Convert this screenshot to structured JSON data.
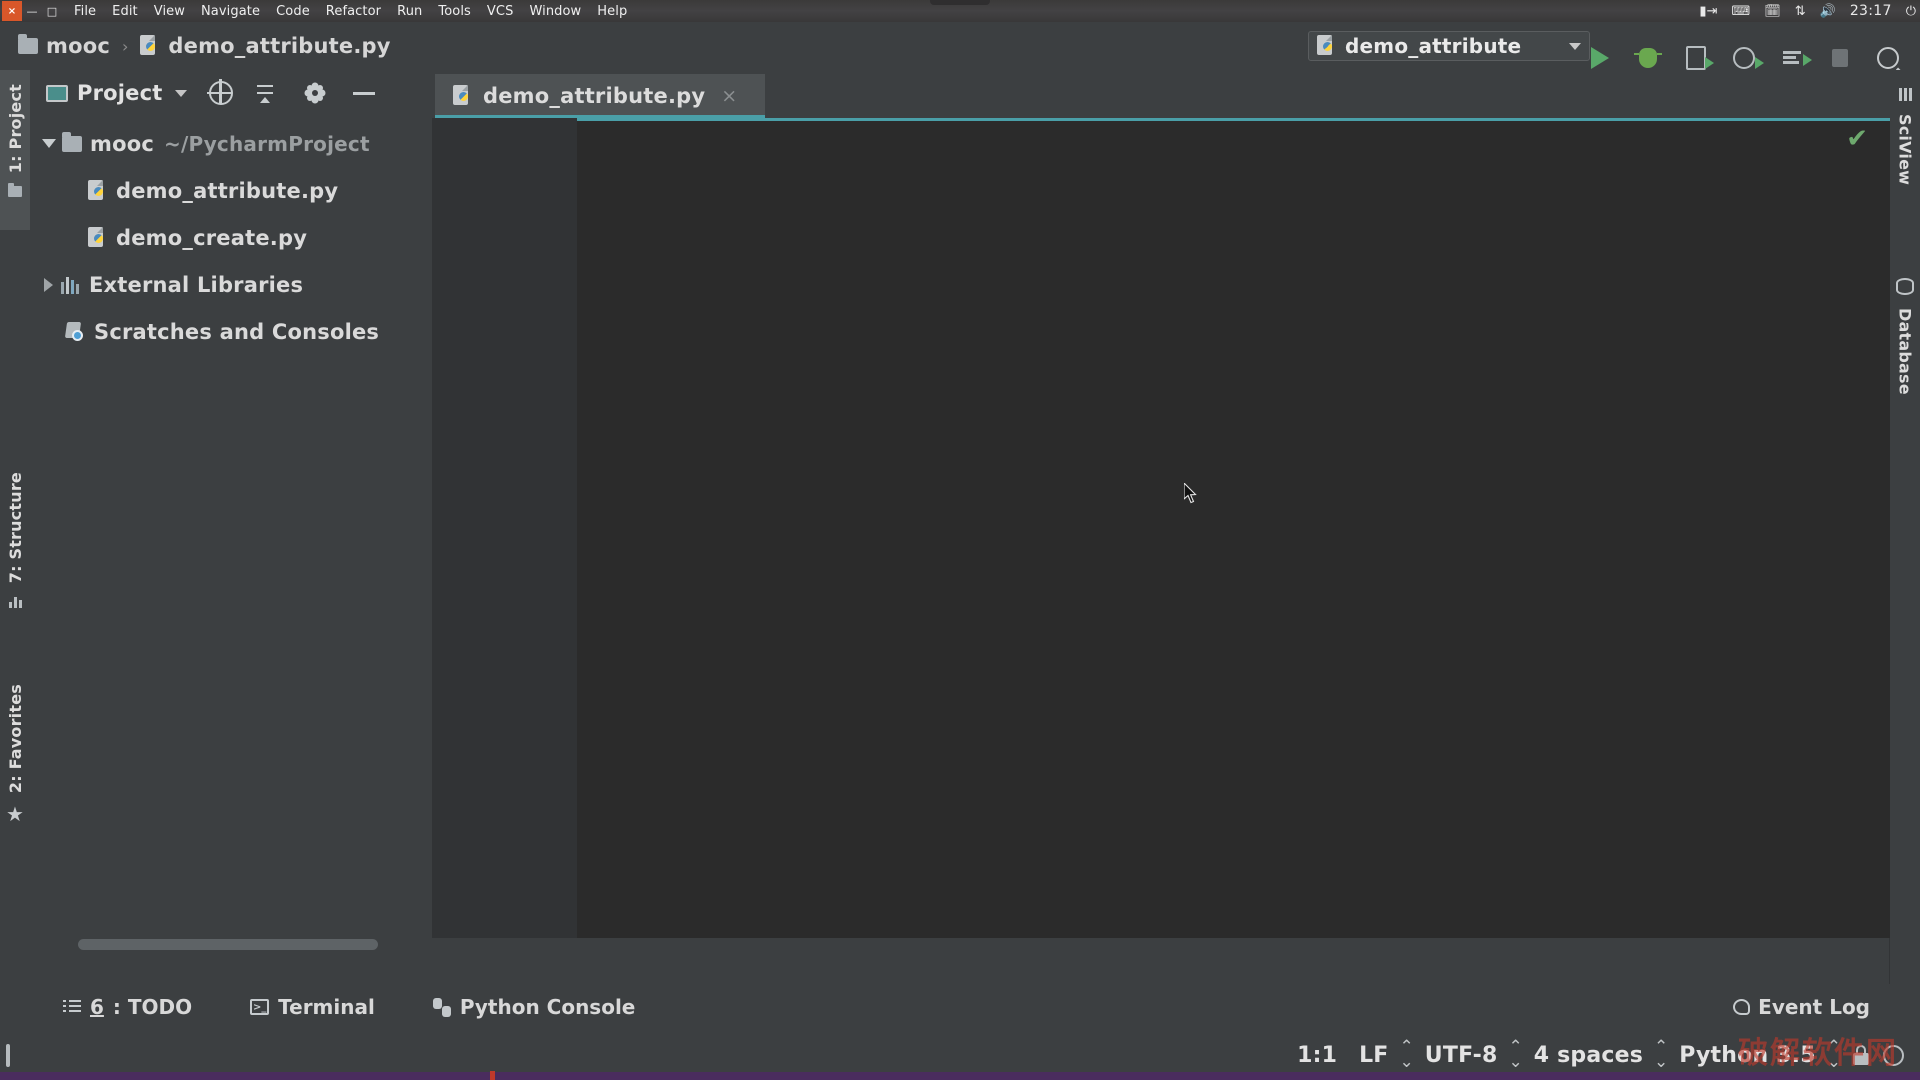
{
  "os_bar": {
    "window_controls": [
      {
        "name": "close",
        "glyph": "×"
      },
      {
        "name": "minimize",
        "glyph": "—"
      },
      {
        "name": "maximize",
        "glyph": "□"
      }
    ],
    "menus": [
      "File",
      "Edit",
      "View",
      "Navigate",
      "Code",
      "Refactor",
      "Run",
      "Tools",
      "VCS",
      "Window",
      "Help"
    ],
    "tray": {
      "input_method_icon": "keyboard-switch-icon",
      "keyboard_icon": "keyboard-icon",
      "calendar_icon": "calendar-icon",
      "network_icon": "network-updown-icon",
      "volume_icon": "volume-icon",
      "clock": "23:17",
      "power_icon": "power-icon"
    }
  },
  "navbar": {
    "breadcrumbs": [
      {
        "label": "mooc",
        "icon": "folder-icon"
      },
      {
        "label": "demo_attribute.py",
        "icon": "python-file-icon"
      }
    ],
    "separator": "›",
    "run_config": {
      "name": "demo_attribute",
      "icon": "python-config-icon",
      "caret": "chevron-down-icon"
    },
    "toolbar_buttons": [
      {
        "name": "run-button",
        "icon": "play-icon"
      },
      {
        "name": "debug-button",
        "icon": "bug-icon"
      },
      {
        "name": "run-with-coverage-button",
        "icon": "coverage-icon"
      },
      {
        "name": "profile-button",
        "icon": "profile-icon"
      },
      {
        "name": "run-with-console-button",
        "icon": "console-run-icon"
      },
      {
        "name": "stop-button",
        "icon": "stop-icon"
      },
      {
        "name": "search-everywhere-button",
        "icon": "search-icon"
      }
    ]
  },
  "left_strip": {
    "tabs": [
      {
        "label": "1: Project",
        "icon": "folder-icon",
        "active": true
      },
      {
        "label": "7: Structure",
        "icon": "structure-icon",
        "active": false
      },
      {
        "label": "2: Favorites",
        "icon": "star-icon",
        "active": false
      }
    ]
  },
  "right_strip": {
    "tabs": [
      {
        "label": "SciView",
        "icon": "sciview-icon"
      },
      {
        "label": "Database",
        "icon": "database-icon"
      }
    ]
  },
  "project_panel": {
    "title": "Project",
    "title_icon": "project-window-icon",
    "caret": "chevron-down-icon",
    "actions": [
      {
        "name": "select-opened-file-button",
        "icon": "target-icon"
      },
      {
        "name": "collapse-all-button",
        "icon": "collapse-all-icon"
      },
      {
        "name": "settings-button",
        "icon": "gear-icon"
      },
      {
        "name": "hide-button",
        "icon": "minimize-icon"
      }
    ],
    "tree": [
      {
        "label": "mooc",
        "path": "~/PycharmProject",
        "icon": "folder-icon",
        "arrow": "expanded",
        "indent": 0
      },
      {
        "label": "demo_attribute.py",
        "path": "",
        "icon": "python-file-icon",
        "arrow": "none",
        "indent": 1
      },
      {
        "label": "demo_create.py",
        "path": "",
        "icon": "python-file-icon",
        "arrow": "none",
        "indent": 1
      },
      {
        "label": "External Libraries",
        "path": "",
        "icon": "libraries-icon",
        "arrow": "collapsed",
        "indent": 0
      },
      {
        "label": "Scratches and Consoles",
        "path": "",
        "icon": "scratches-icon",
        "arrow": "none",
        "indent": 0
      }
    ]
  },
  "editor": {
    "tabs": [
      {
        "label": "demo_attribute.py",
        "icon": "python-file-icon",
        "close": "×",
        "active": true
      }
    ],
    "content": "",
    "inspection_status_icon": "checkmark-icon",
    "cursor_icon": "mouse-pointer-icon"
  },
  "bottom_bar": {
    "items": [
      {
        "label_prefix": "6",
        "label": ": TODO",
        "icon": "todo-icon"
      },
      {
        "label_prefix": "",
        "label": "Terminal",
        "icon": "terminal-icon"
      },
      {
        "label_prefix": "",
        "label": "Python Console",
        "icon": "python-console-icon"
      }
    ],
    "event_log": {
      "label": "Event Log",
      "icon": "event-log-icon"
    }
  },
  "status_bar": {
    "maximize_icon": "maximize-window-icon",
    "items": [
      {
        "name": "caret-position",
        "value": "1:1",
        "has_dots": false
      },
      {
        "name": "line-separator",
        "value": "LF",
        "has_dots": true
      },
      {
        "name": "file-encoding",
        "value": "UTF-8",
        "has_dots": true
      },
      {
        "name": "indent",
        "value": "4 spaces",
        "has_dots": true
      },
      {
        "name": "interpreter",
        "value": "Python 3.5",
        "has_dots": true
      }
    ],
    "lock_icon": "lock-icon",
    "smiley_icon": "smiley-icon",
    "watermark": "破解软件网"
  },
  "colors": {
    "accent_teal": "#4a9fa8",
    "run_green": "#59a869",
    "panel_bg": "#3c3f41",
    "editor_bg": "#2b2b2b",
    "gutter_bg": "#313335",
    "tab_active_bg": "#4e5254",
    "text": "#dcdcdc",
    "muted_text": "#9b9fa1",
    "close_button": "#d9572a",
    "watermark_red": "#c0392b"
  }
}
